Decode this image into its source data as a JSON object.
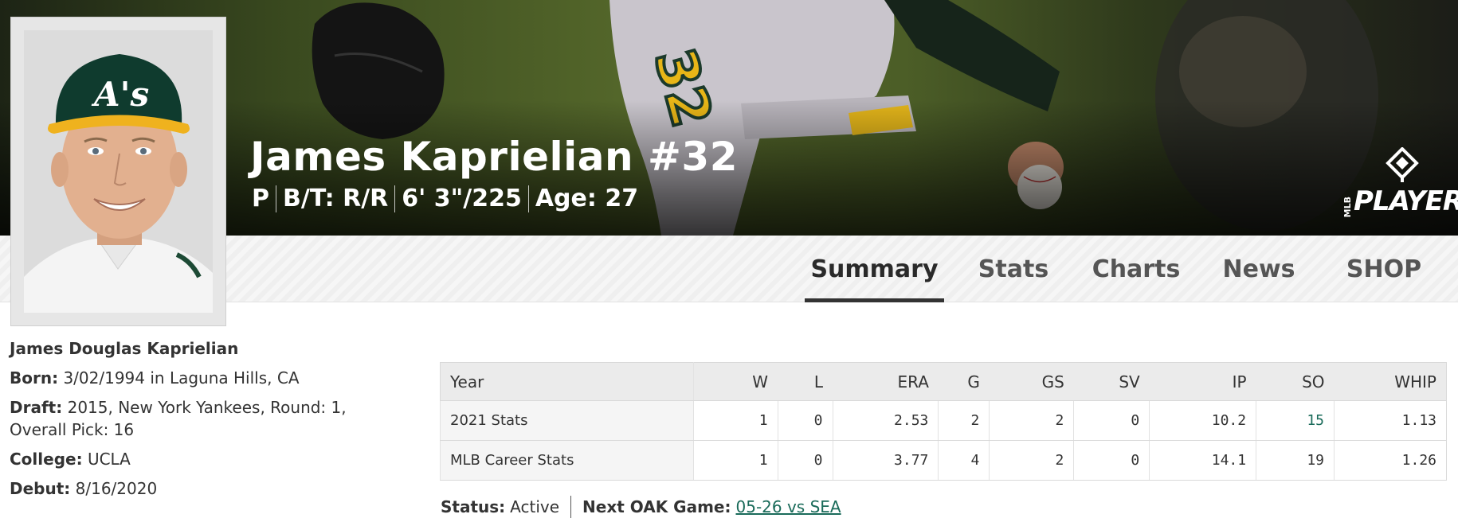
{
  "player": {
    "name_number": "James Kaprielian #32",
    "meta": [
      "P",
      "B/T: R/R",
      "6' 3\"/225",
      "Age: 27"
    ]
  },
  "logo": {
    "mlb": "MLB",
    "players": "PLAYERS"
  },
  "tabs": [
    {
      "label": "Summary",
      "active": true
    },
    {
      "label": "Stats",
      "active": false
    },
    {
      "label": "Charts",
      "active": false
    },
    {
      "label": "News",
      "active": false
    },
    {
      "label": "SHOP",
      "active": false
    }
  ],
  "bio": {
    "full_name": "James Douglas Kaprielian",
    "born_label": "Born:",
    "born_value": "3/02/1994 in Laguna Hills, CA",
    "draft_label": "Draft:",
    "draft_value": "2015, New York Yankees, Round: 1, Overall Pick: 16",
    "college_label": "College:",
    "college_value": "UCLA",
    "debut_label": "Debut:",
    "debut_value": "8/16/2020"
  },
  "stats_table": {
    "headers": [
      "Year",
      "W",
      "L",
      "ERA",
      "G",
      "GS",
      "SV",
      "IP",
      "SO",
      "WHIP"
    ],
    "rows": [
      [
        "2021 Stats",
        "1",
        "0",
        "2.53",
        "2",
        "2",
        "0",
        "10.2",
        "15",
        "1.13"
      ],
      [
        "MLB Career Stats",
        "1",
        "0",
        "3.77",
        "4",
        "2",
        "0",
        "14.1",
        "19",
        "1.26"
      ]
    ]
  },
  "status": {
    "status_label": "Status:",
    "status_value": "Active",
    "next_game_label": "Next OAK Game:",
    "next_game_value": "05-26 vs SEA"
  },
  "colors": {
    "cap_green": "#0f3b2e",
    "cap_gold": "#efb21e",
    "link": "#1a6b5a"
  }
}
